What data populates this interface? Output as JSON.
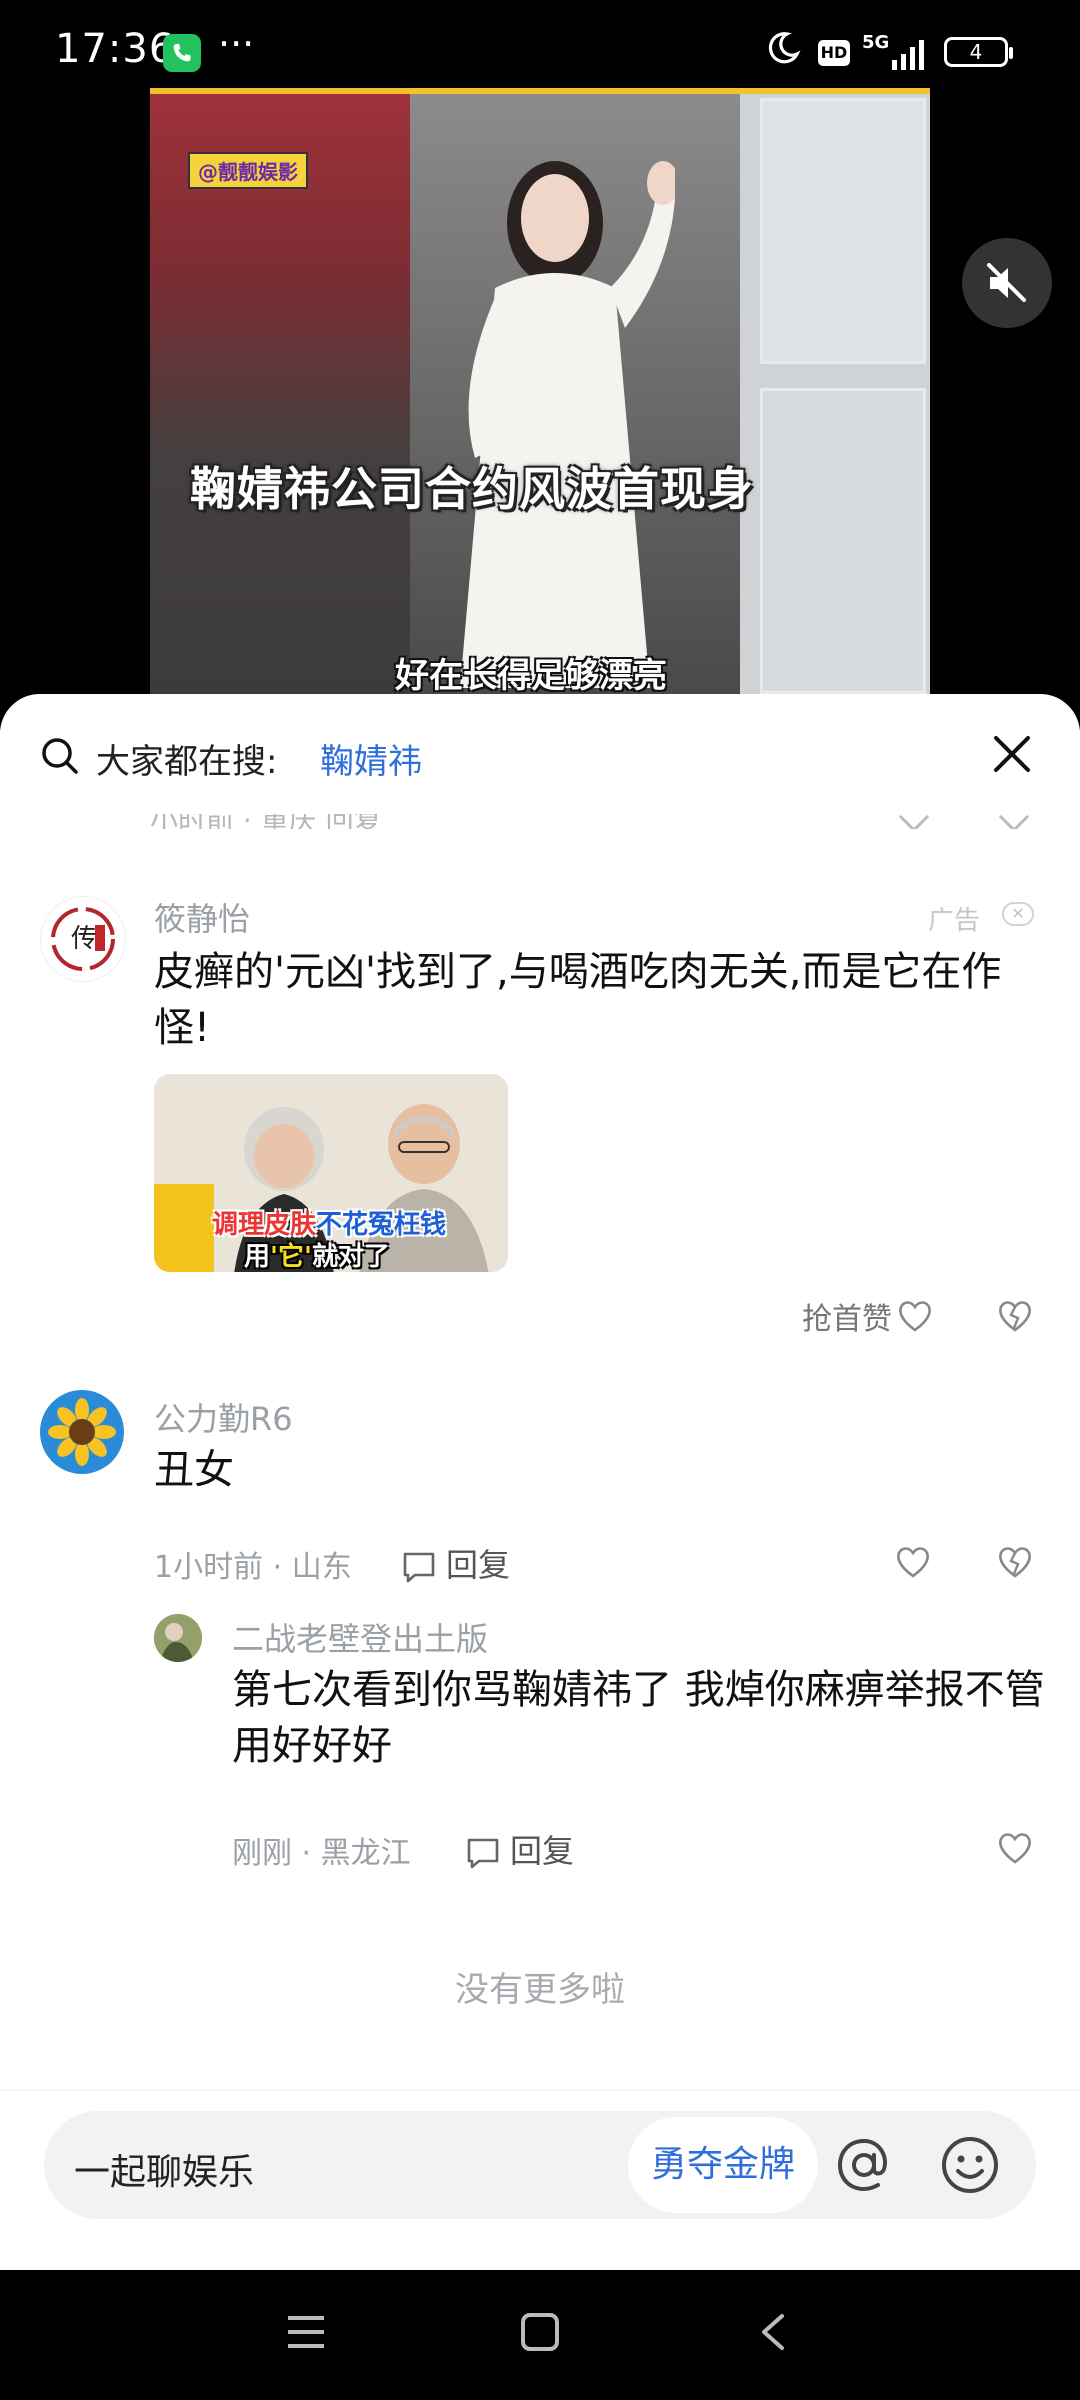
{
  "status_bar": {
    "time": "17:36",
    "more": "···",
    "hd": "HD",
    "network": "5G",
    "battery": "4"
  },
  "video": {
    "watermark": "@靓靓娱影",
    "headline": "鞠婧祎公司合约风波首现身",
    "subtitle": "好在长得足够漂亮"
  },
  "search": {
    "prefix": "大家都在搜:",
    "keyword": "鞠婧祎"
  },
  "cut_row": {
    "text": "小时前 · 重庆   回复"
  },
  "ad": {
    "username": "筱静怡",
    "label": "广告",
    "text": "皮癣的'元凶'找到了,与喝酒吃肉无关,而是它在作怪!",
    "image_caption_red": "调理皮肤",
    "image_caption_blue": "不花冤枉钱",
    "image_caption_line2_a": "用",
    "image_caption_line2_b": "'它'",
    "image_caption_line2_c": "就对了",
    "first_like": "抢首赞"
  },
  "comment": {
    "username": "公力勤R6",
    "text": "丑女",
    "time_location": "1小时前 · 山东",
    "reply_label": "回复"
  },
  "reply": {
    "username": "二战老壁登出土版",
    "text": "第七次看到你骂鞠婧祎了 我焯你麻痹举报不管用好好好",
    "time_location": "刚刚 · 黑龙江",
    "reply_label": "回复"
  },
  "no_more": "没有更多啦",
  "input": {
    "placeholder": "一起聊娱乐",
    "tag": "勇夺金牌"
  },
  "colors": {
    "accent": "#2f6fdc",
    "gray_text": "#9aa0a6"
  }
}
